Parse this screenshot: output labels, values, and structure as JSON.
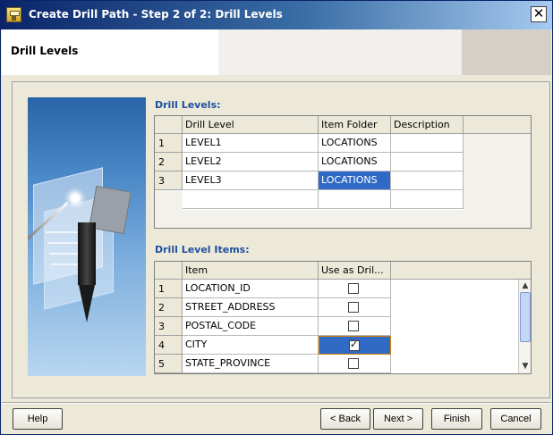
{
  "window": {
    "title": "Create Drill Path - Step 2 of 2: Drill Levels",
    "close_glyph": "✕"
  },
  "header": {
    "page_title": "Drill Levels"
  },
  "drill_levels": {
    "label": "Drill Levels:",
    "columns": [
      "Drill Level",
      "Item Folder",
      "Description"
    ],
    "rows": [
      {
        "num": "1",
        "level": "LEVEL1",
        "folder": "LOCATIONS",
        "description": ""
      },
      {
        "num": "2",
        "level": "LEVEL2",
        "folder": "LOCATIONS",
        "description": ""
      },
      {
        "num": "3",
        "level": "LEVEL3",
        "folder": "LOCATIONS",
        "description": ""
      }
    ]
  },
  "drill_level_items": {
    "label": "Drill Level Items:",
    "columns": [
      "Item",
      "Use as Dril..."
    ],
    "rows": [
      {
        "num": "1",
        "item": "LOCATION_ID",
        "checked": false
      },
      {
        "num": "2",
        "item": "STREET_ADDRESS",
        "checked": false
      },
      {
        "num": "3",
        "item": "POSTAL_CODE",
        "checked": false
      },
      {
        "num": "4",
        "item": "CITY",
        "checked": true
      },
      {
        "num": "5",
        "item": "STATE_PROVINCE",
        "checked": false
      }
    ]
  },
  "buttons": {
    "help": "Help",
    "back": "< Back",
    "next": "Next >",
    "finish": "Finish",
    "cancel": "Cancel"
  },
  "colors": {
    "selection": "#316ac5",
    "label": "#1f4f9f"
  },
  "icons": [
    "app-icon",
    "close-icon",
    "scroll-up-icon",
    "scroll-down-icon",
    "checkbox-icon"
  ]
}
